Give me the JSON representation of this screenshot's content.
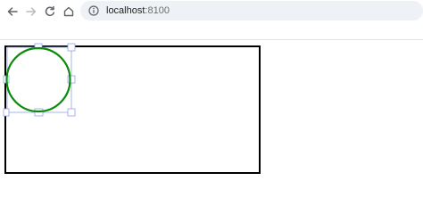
{
  "browser": {
    "url_host": "localhost",
    "url_port": ":8100",
    "icons": {
      "back": "back-arrow-icon",
      "forward": "forward-arrow-icon",
      "reload": "reload-icon",
      "home": "home-icon",
      "info": "info-icon"
    }
  },
  "canvas": {
    "border_color": "#000000",
    "shape": {
      "type": "circle",
      "stroke_color": "#0a8a0a",
      "selected": true,
      "selection_color": "#8fa3ee"
    }
  }
}
